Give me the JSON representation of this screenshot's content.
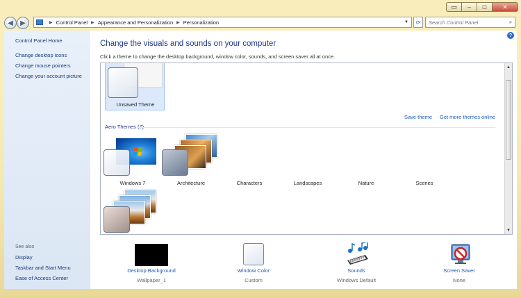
{
  "window": {
    "caption_buttons": [
      "restore-layout",
      "minimize",
      "maximize",
      "close"
    ]
  },
  "address_bar": {
    "crumbs": [
      "Control Panel",
      "Appearance and Personalization",
      "Personalization"
    ],
    "search_placeholder": "Search Control Panel"
  },
  "sidebar": {
    "home": "Control Panel Home",
    "links": [
      "Change desktop icons",
      "Change mouse pointers",
      "Change your account picture"
    ],
    "see_also_label": "See also",
    "see_also": [
      "Display",
      "Taskbar and Start Menu",
      "Ease of Access Center"
    ]
  },
  "main": {
    "title": "Change the visuals and sounds on your computer",
    "subtitle": "Click a theme to change the desktop background, window color, sounds, and screen saver all at once."
  },
  "gallery": {
    "unsaved_label": "Unsaved Theme",
    "save_theme": "Save theme",
    "get_more": "Get more themes online",
    "section": "Aero Themes (7)",
    "themes": [
      "Windows 7",
      "Architecture",
      "Characters",
      "Landscapes",
      "Nature",
      "Scenes"
    ]
  },
  "bottom": {
    "items": [
      {
        "link": "Desktop Background",
        "value": "Wallpaper_1"
      },
      {
        "link": "Window Color",
        "value": "Custom"
      },
      {
        "link": "Sounds",
        "value": "Windows Default"
      },
      {
        "link": "Screen Saver",
        "value": "None"
      }
    ]
  },
  "colors": {
    "link": "#1a5ab8",
    "title": "#1e3a8a",
    "selection": "#dbe9fb",
    "desktop_background_swatch": "#000000"
  }
}
